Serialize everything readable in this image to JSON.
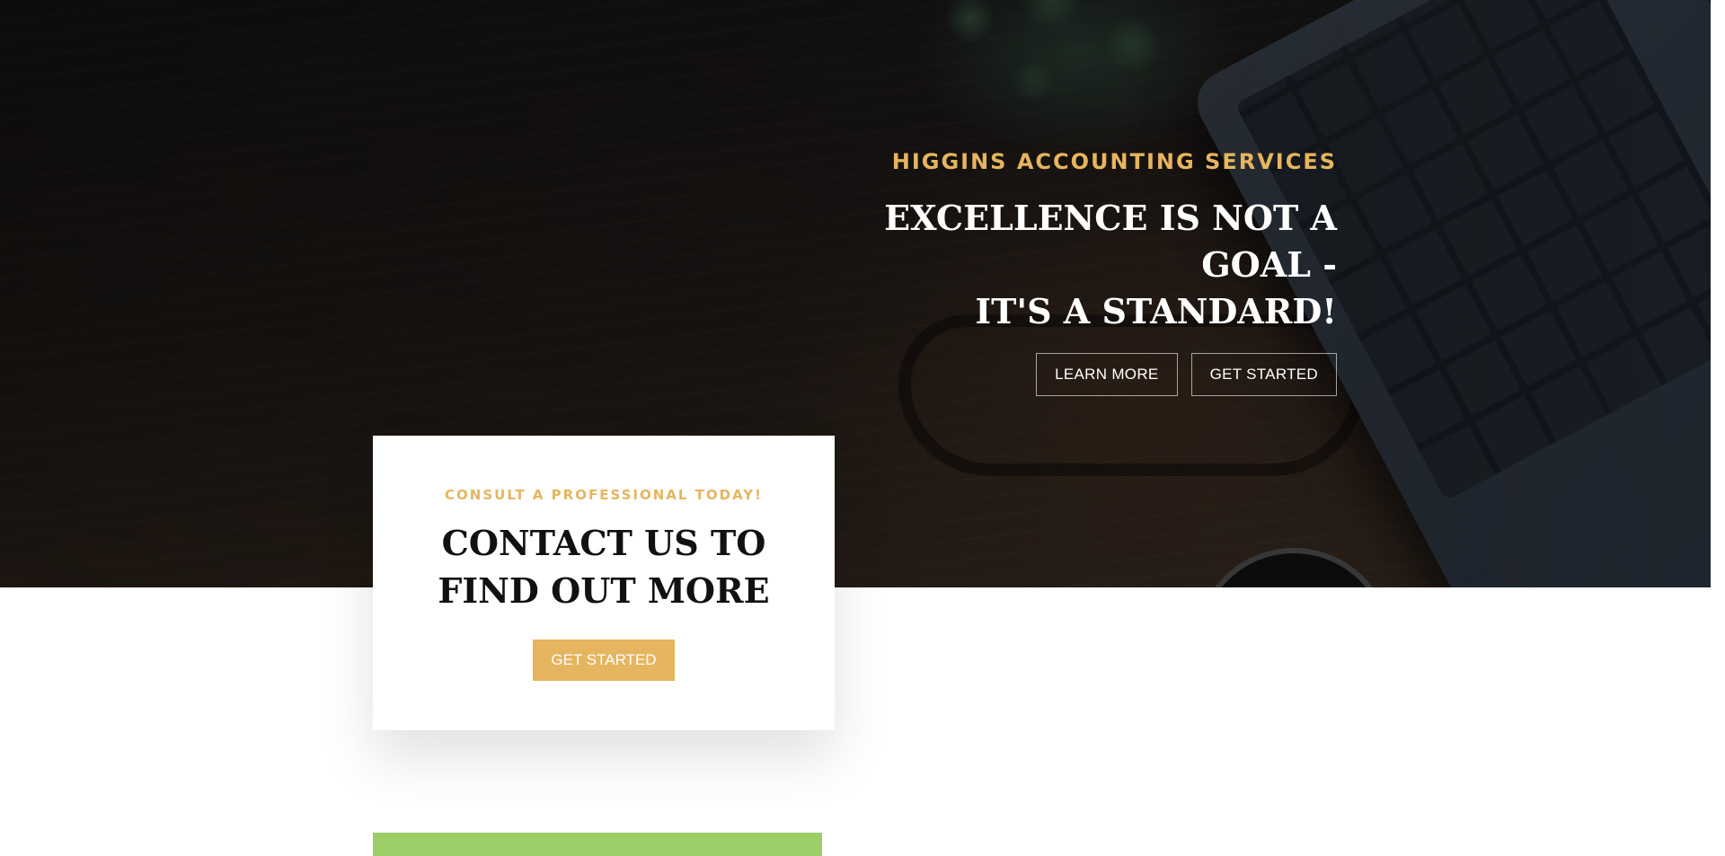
{
  "hero": {
    "kicker": "HIGGINS ACCOUNTING SERVICES",
    "title_line1": "EXCELLENCE IS NOT A GOAL -",
    "title_line2": "IT'S A STANDARD!",
    "buttons": {
      "learn_more": "LEARN MORE",
      "get_started": "GET STARTED"
    }
  },
  "contact": {
    "kicker": "CONSULT A PROFESSIONAL TODAY!",
    "title": "CONTACT US TO FIND OUT MORE",
    "button": "GET STARTED"
  },
  "colors": {
    "accent_gold": "#e6b55f",
    "green_block": "#9ccd66",
    "hero_dark": "#1c1714"
  }
}
